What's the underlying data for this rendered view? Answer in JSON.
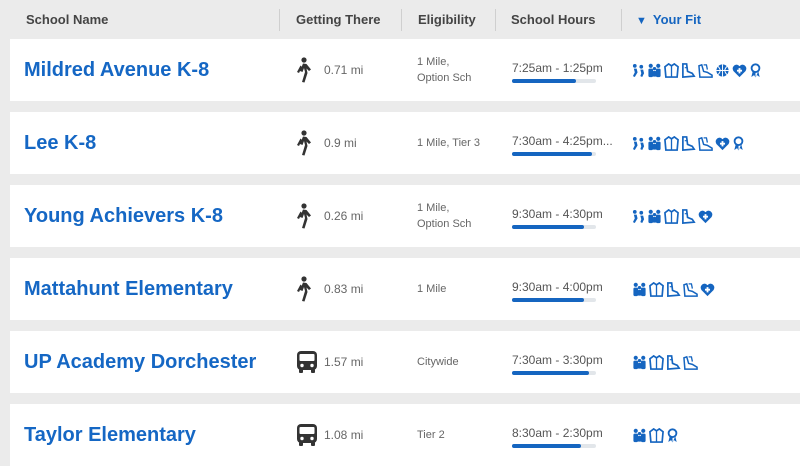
{
  "header": {
    "school_name": "School Name",
    "getting_there": "Getting There",
    "eligibility": "Eligibility",
    "school_hours": "School Hours",
    "your_fit": "Your Fit",
    "sort_icon": "triangle-down-icon"
  },
  "colors": {
    "accent": "#1565c0",
    "row_bg": "#ffffff",
    "page_bg": "#ebebeb"
  },
  "schools": [
    {
      "name": "Mildred Avenue K-8",
      "mode": "walk",
      "distance": "0.71 mi",
      "eligibility": [
        "1 Mile,",
        "Option Sch"
      ],
      "hours": "7:25am - 1:25pm",
      "hours_bar": 0.76,
      "fit_icons": [
        "sports-icon",
        "family-icon",
        "uniform-icon",
        "dance-icon",
        "shoes-icon",
        "basketball-icon",
        "health-icon",
        "ribbon-icon"
      ]
    },
    {
      "name": "Lee K-8",
      "mode": "walk",
      "distance": "0.9 mi",
      "eligibility": [
        "1 Mile, Tier 3"
      ],
      "hours": "7:30am - 4:25pm...",
      "hours_bar": 0.95,
      "fit_icons": [
        "sports-icon",
        "family-icon",
        "uniform-icon",
        "dance-icon",
        "shoes-icon",
        "health-icon",
        "ribbon-icon"
      ]
    },
    {
      "name": "Young Achievers K-8",
      "mode": "walk",
      "distance": "0.26 mi",
      "eligibility": [
        "1 Mile,",
        "Option Sch"
      ],
      "hours": "9:30am - 4:30pm",
      "hours_bar": 0.86,
      "fit_icons": [
        "sports-icon",
        "family-icon",
        "uniform-icon",
        "dance-icon",
        "health-icon"
      ]
    },
    {
      "name": "Mattahunt Elementary",
      "mode": "walk",
      "distance": "0.83 mi",
      "eligibility": [
        "1 Mile"
      ],
      "hours": "9:30am - 4:00pm",
      "hours_bar": 0.86,
      "fit_icons": [
        "family-icon",
        "uniform-icon",
        "dance-icon",
        "shoes-icon",
        "health-icon"
      ]
    },
    {
      "name": "UP Academy Dorchester",
      "mode": "bus",
      "distance": "1.57 mi",
      "eligibility": [
        "Citywide"
      ],
      "hours": "7:30am - 3:30pm",
      "hours_bar": 0.92,
      "fit_icons": [
        "family-icon",
        "uniform-icon",
        "dance-icon",
        "shoes-icon"
      ]
    },
    {
      "name": "Taylor Elementary",
      "mode": "bus",
      "distance": "1.08 mi",
      "eligibility": [
        "Tier 2"
      ],
      "hours": "8:30am - 2:30pm",
      "hours_bar": 0.82,
      "fit_icons": [
        "family-icon",
        "uniform-icon",
        "ribbon-icon"
      ]
    }
  ]
}
